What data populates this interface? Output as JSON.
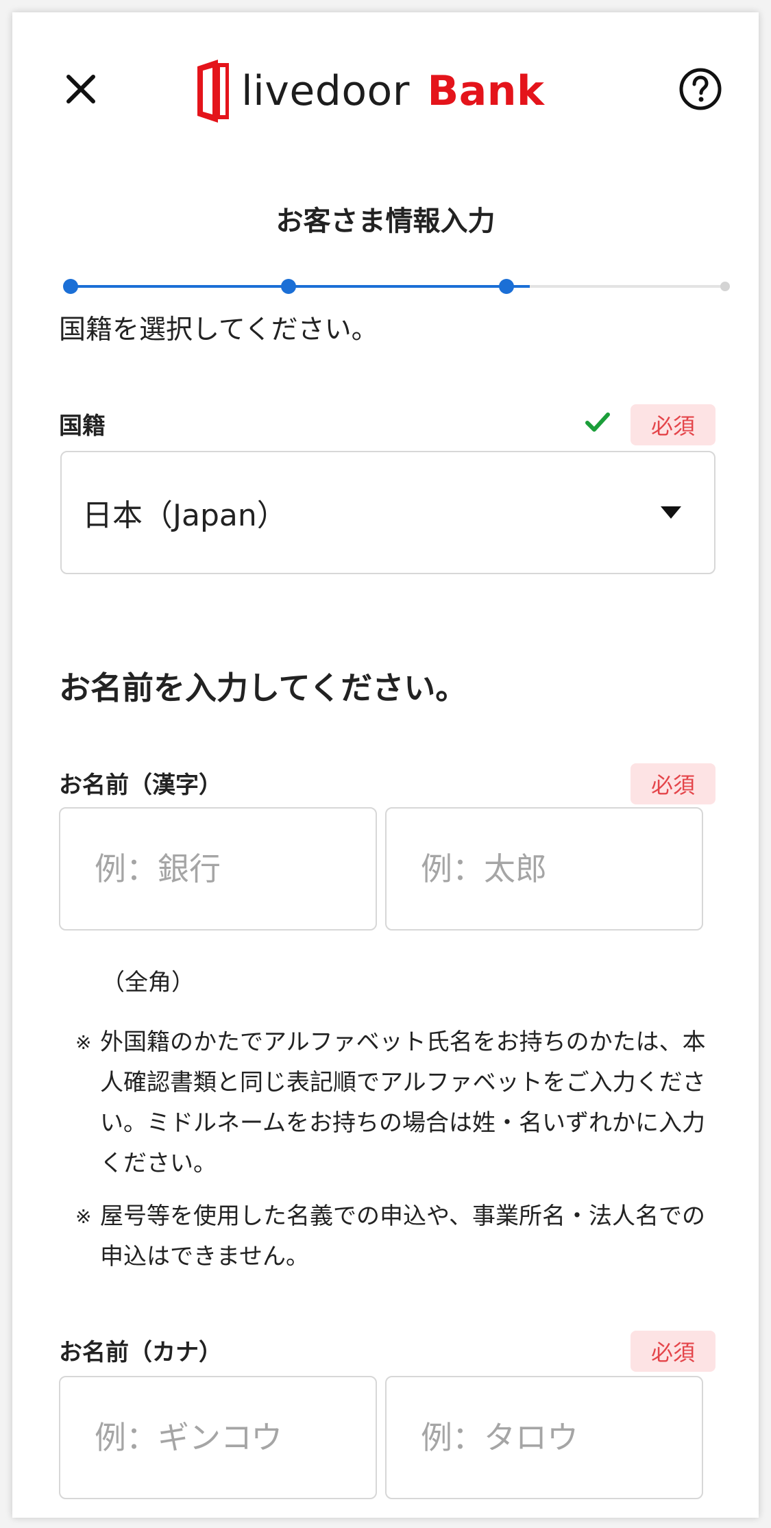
{
  "header": {
    "logo_text": "livedoor",
    "logo_bank": "Bank",
    "brand_color": "#e4141b"
  },
  "page": {
    "title": "お客さま情報入力",
    "progress": {
      "steps_total": 4,
      "current_step": 3,
      "accent_color": "#1b6fd6"
    }
  },
  "nationality": {
    "instruction": "国籍を選択してください。",
    "label": "国籍",
    "required": "必須",
    "selected": "日本（Japan）",
    "valid": true
  },
  "name_section": {
    "title": "お名前を入力してください。",
    "kanji": {
      "label": "お名前（漢字）",
      "required": "必須",
      "last_placeholder": "例：銀行",
      "first_placeholder": "例：太郎",
      "hint": "（全角）"
    },
    "notes": [
      {
        "mark": "※",
        "text": "外国籍のかたでアルファベット氏名をお持ちのかたは、本人確認書類と同じ表記順でアルファベットをご入力ください。ミドルネームをお持ちの場合は姓・名いずれかに入力ください。"
      },
      {
        "mark": "※",
        "text": "屋号等を使用した名義での申込や、事業所名・法人名での申込はできません。"
      }
    ],
    "kana": {
      "label": "お名前（カナ）",
      "required": "必須",
      "last_placeholder": "例：ギンコウ",
      "first_placeholder": "例：タロウ"
    }
  },
  "icons": {
    "close": "close-icon",
    "help": "help-circle-icon",
    "check": "check-icon",
    "caret": "caret-down-icon"
  }
}
